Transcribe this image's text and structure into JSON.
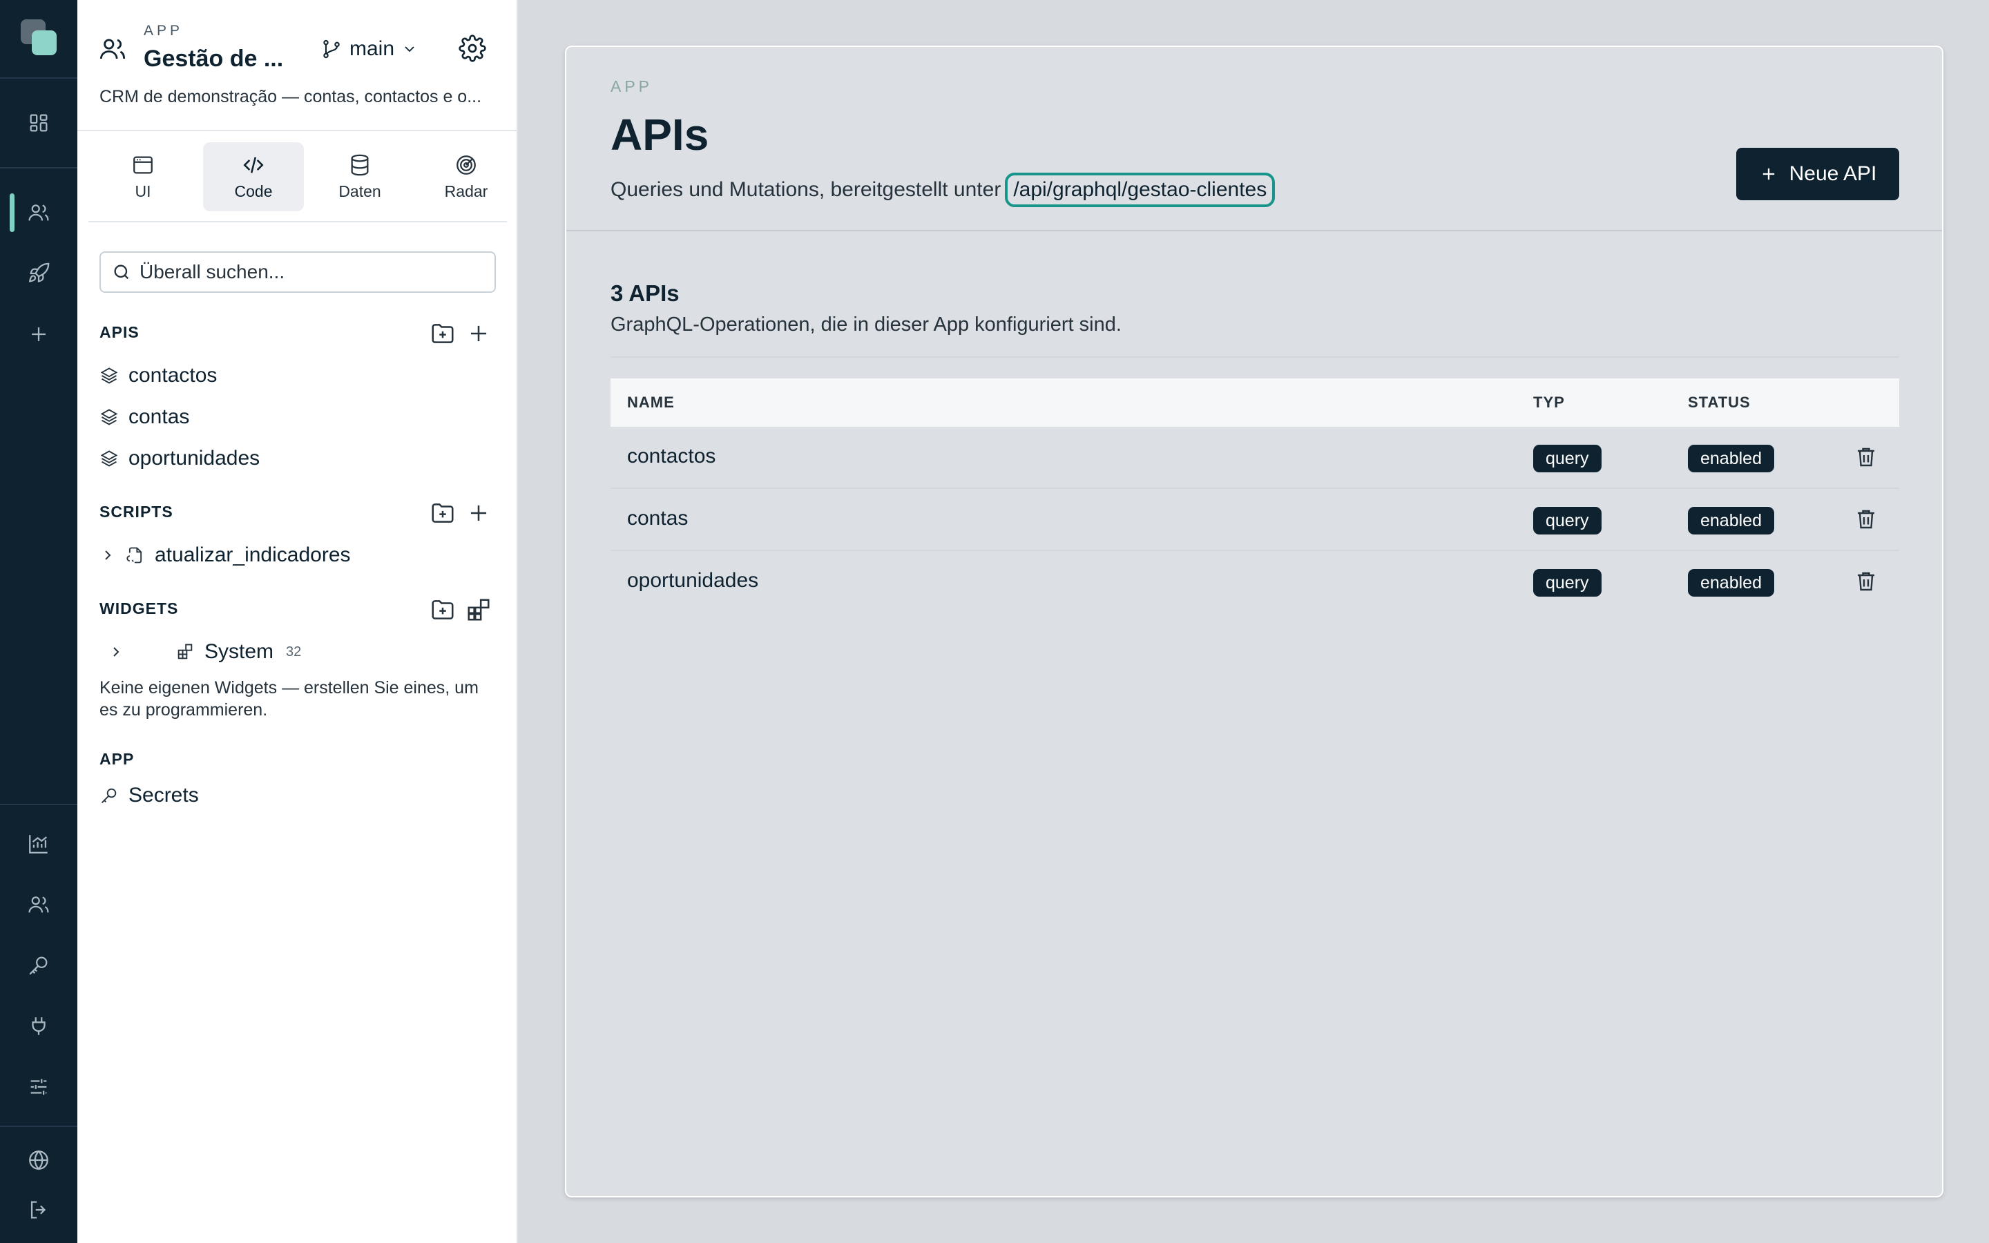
{
  "rail": {
    "icons": [
      "app-logo",
      "dashboard-icon",
      "users-icon",
      "rocket-icon",
      "plus-icon",
      "chart-icon",
      "team-icon",
      "key-icon",
      "plug-icon",
      "sliders-icon",
      "globe-icon",
      "logout-icon"
    ],
    "active": "users-icon",
    "accent": "#7fd1c4"
  },
  "app": {
    "kicker": "APP",
    "title": "Gestão de ...",
    "branch": "main",
    "description": "CRM de demonstração — contas, contactos e o..."
  },
  "modes": [
    {
      "label": "UI",
      "icon": "window-icon"
    },
    {
      "label": "Code",
      "icon": "code-icon"
    },
    {
      "label": "Daten",
      "icon": "database-icon"
    },
    {
      "label": "Radar",
      "icon": "radar-icon"
    }
  ],
  "active_mode": "Code",
  "search": {
    "placeholder": "Überall suchen..."
  },
  "sections": {
    "apis": {
      "title": "APIS",
      "items": [
        "contactos",
        "contas",
        "oportunidades"
      ]
    },
    "scripts": {
      "title": "SCRIPTS",
      "items": [
        "atualizar_indicadores"
      ]
    },
    "widgets": {
      "title": "WIDGETS",
      "group": "System",
      "count": "32",
      "hint": "Keine eigenen Widgets — erstellen Sie eines, um es zu programmieren."
    },
    "app": {
      "title": "APP",
      "items": [
        "Secrets"
      ]
    }
  },
  "main": {
    "kicker": "APP",
    "title": "APIs",
    "subtitle": "Queries und Mutations, bereitgestellt unter",
    "endpoint": "/api/graphql/gestao-clientes",
    "new_button": "Neue API",
    "count_title": "3 APIs",
    "count_subtitle": "GraphQL-Operationen, die in dieser App konfiguriert sind.",
    "columns": [
      "NAME",
      "TYP",
      "STATUS"
    ],
    "rows": [
      {
        "name": "contactos",
        "type": "query",
        "status": "enabled"
      },
      {
        "name": "contas",
        "type": "query",
        "status": "enabled"
      },
      {
        "name": "oportunidades",
        "type": "query",
        "status": "enabled"
      }
    ],
    "highlight_color": "#17958a"
  }
}
